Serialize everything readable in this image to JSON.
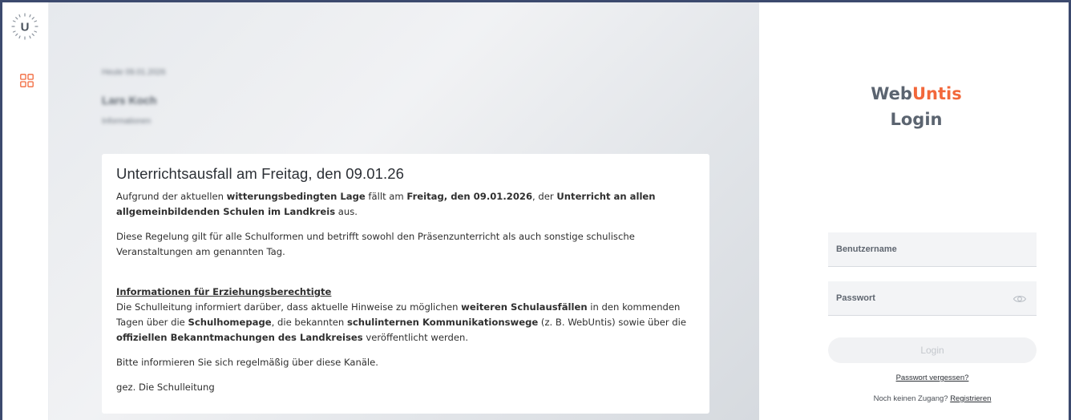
{
  "rail": {
    "logo_letter": "U",
    "logo_icon": "untis-sun-logo-icon",
    "nav_icon": "dashboard-grid-icon",
    "accent_color": "#f2683b"
  },
  "background": {
    "blurred_date": "Heute 09.01.2026",
    "blurred_name": "Lars Koch",
    "blurred_subtitle": "Informationen"
  },
  "message": {
    "title": "Unterrichtsausfall am Freitag, den 09.01.26",
    "p1_a": "Aufgrund der aktuellen ",
    "p1_b": "witterungsbedingten Lage",
    "p1_c": " fällt am ",
    "p1_d": "Freitag, den 09.01.2026",
    "p1_e": ", der ",
    "p1_f": "Unterricht an allen allgemeinbildenden Schulen im Landkreis",
    "p1_g": " aus.",
    "p2": "Diese Regelung gilt für alle Schulformen und betrifft sowohl den Präsenzunterricht als auch sonstige schulische Veranstaltungen am genannten Tag.",
    "p3_heading": "Informationen für Erziehungsberechtigte",
    "p3_a": "Die Schulleitung informiert darüber, dass aktuelle Hinweise zu möglichen ",
    "p3_b": "weiteren Schulausfällen",
    "p3_c": " in den kommenden Tagen über die ",
    "p3_d": "Schulhomepage",
    "p3_e": ", die bekannten ",
    "p3_f": "schulinternen Kommunikationswege",
    "p3_g": " (z. B. WebUntis) sowie über die ",
    "p3_h": "offiziellen Bekanntmachungen des Landkreises",
    "p3_i": " veröffentlicht werden.",
    "p4": "Bitte informieren Sie sich regelmäßig über diese Kanäle.",
    "p5": "gez. Die Schulleitung"
  },
  "login": {
    "brand_prefix": "Web",
    "brand_accent": "Untis",
    "title": "Login",
    "username_placeholder": "Benutzername",
    "username_value": "",
    "password_placeholder": "Passwort",
    "password_value": "",
    "eye_icon": "eye-icon",
    "login_button": "Login",
    "forgot_link": "Passwort vergessen?",
    "no_access_text": "Noch keinen Zugang? ",
    "register_link": "Registrieren",
    "brand_color": "#5b6470",
    "accent_color": "#f2683b"
  }
}
